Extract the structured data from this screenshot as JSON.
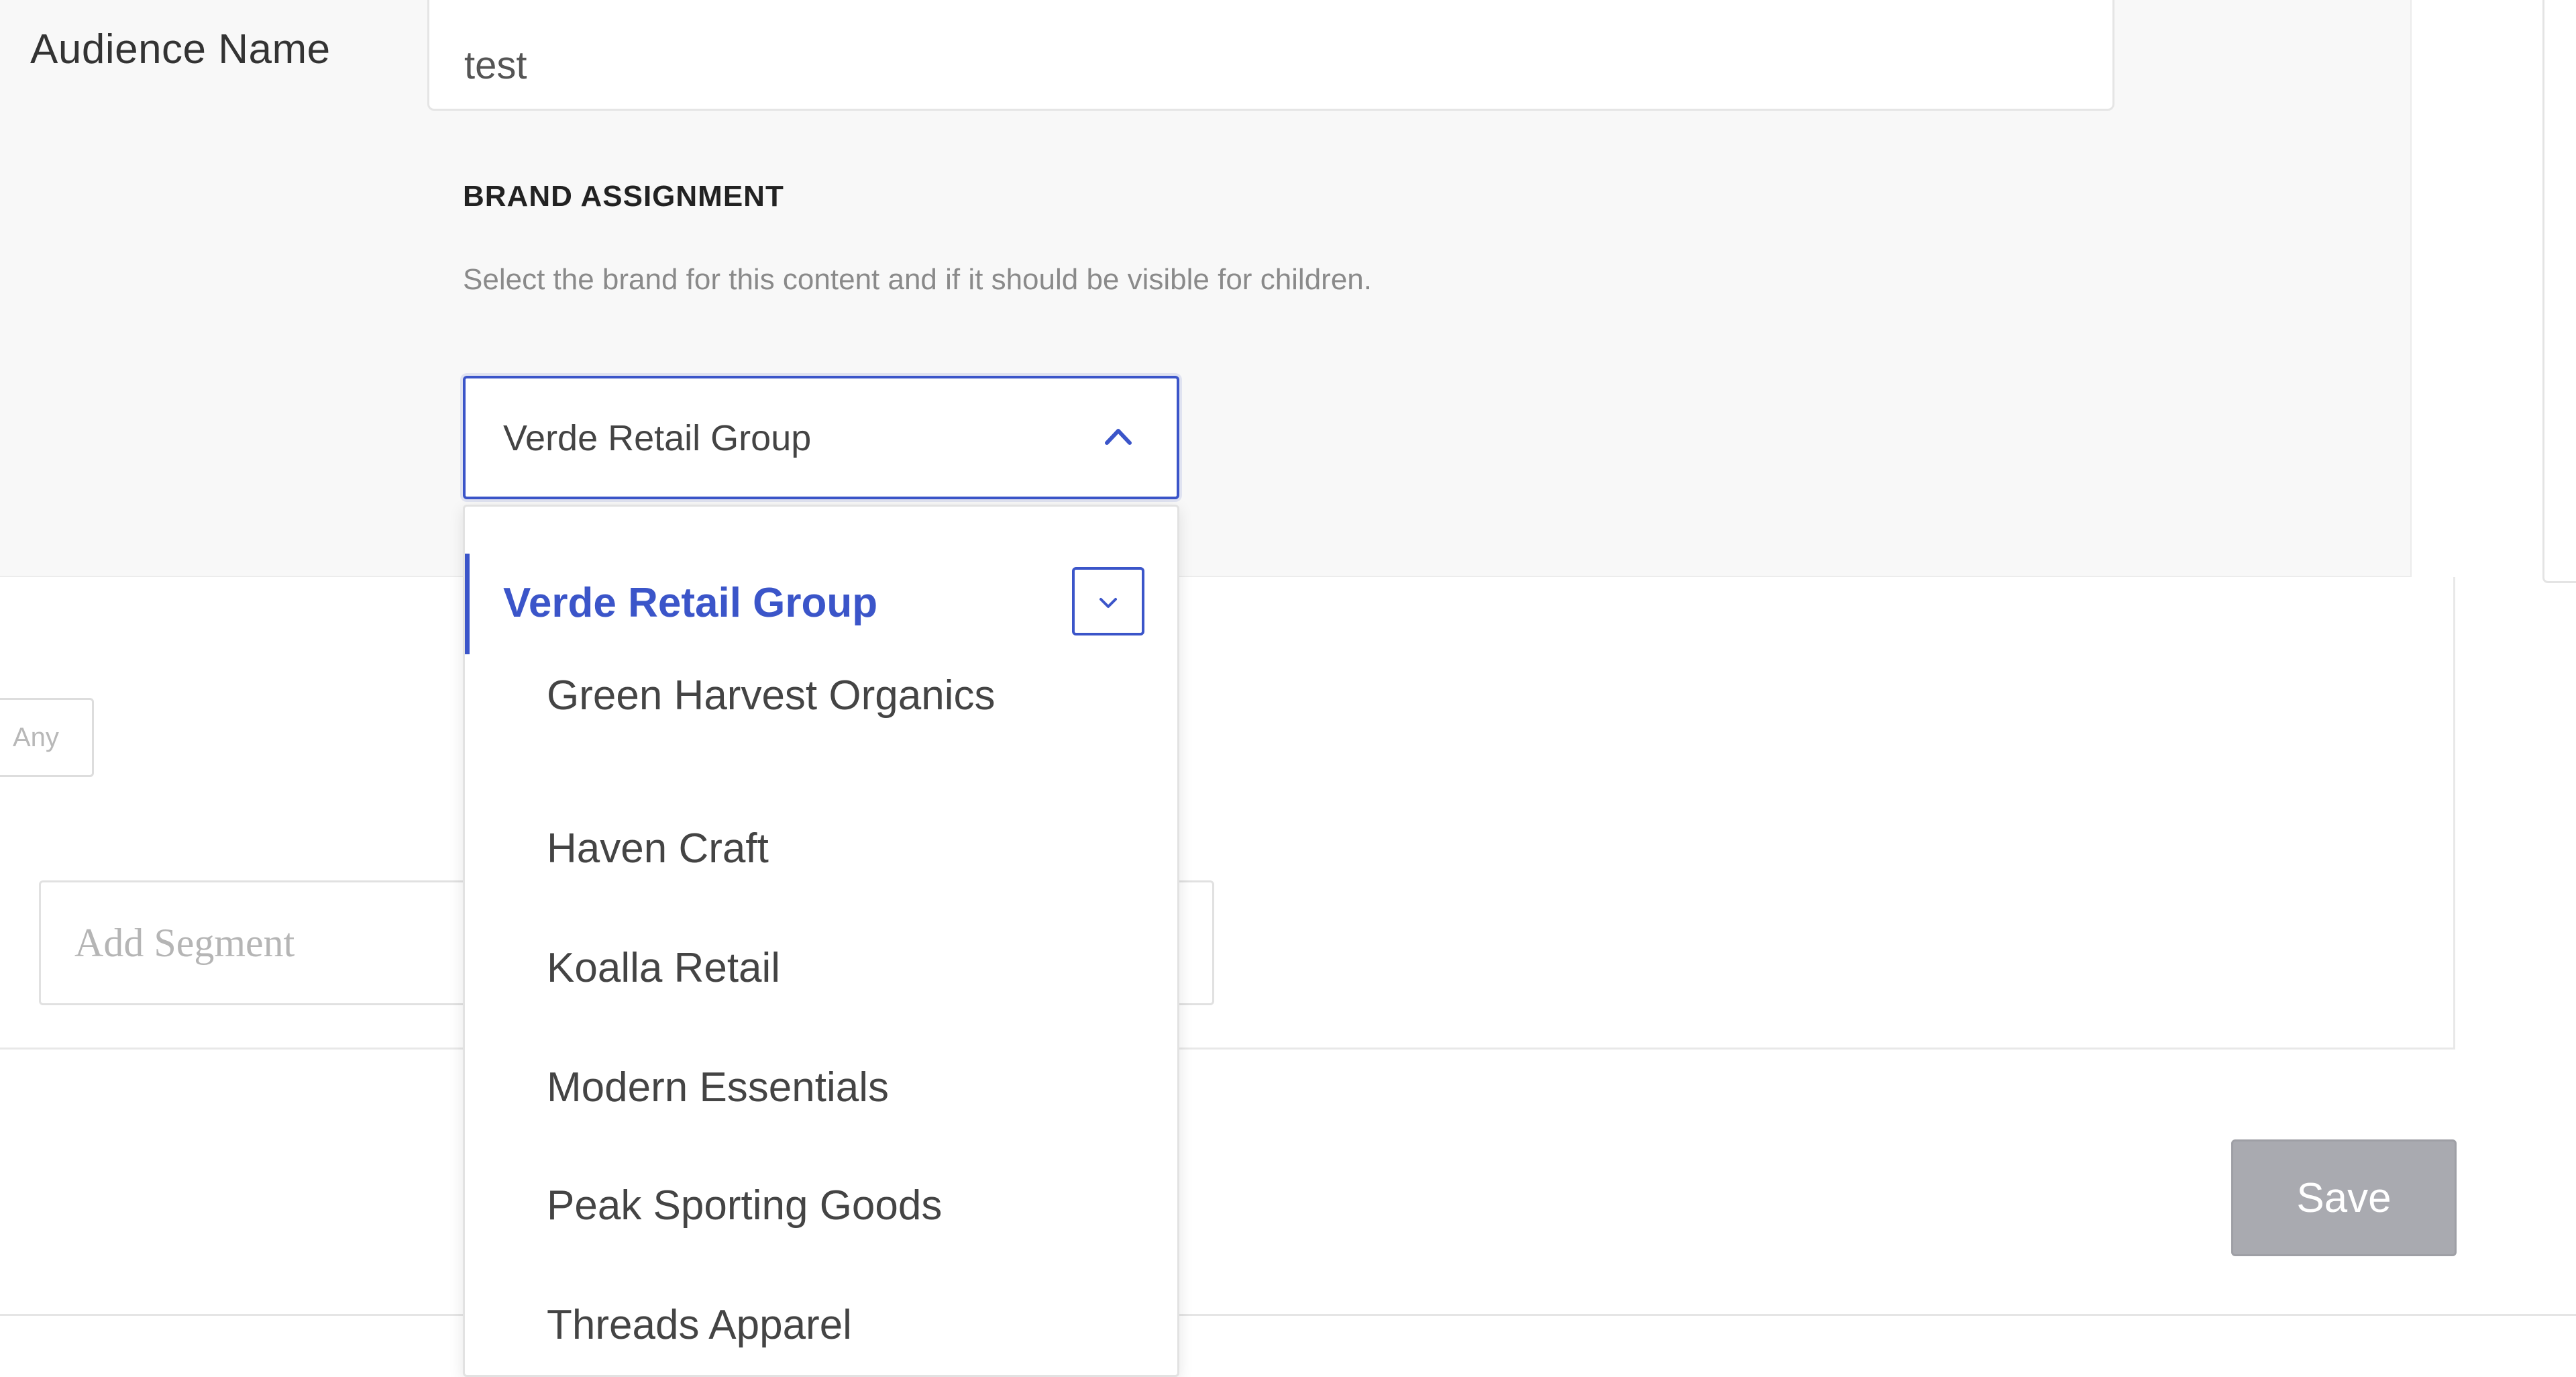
{
  "form": {
    "audience_name_label": "Audience Name",
    "audience_name_value": "test"
  },
  "brand_assignment": {
    "heading": "BRAND ASSIGNMENT",
    "help_text": "Select the brand for this content and if it should be visible for children.",
    "selected_value": "Verde Retail Group"
  },
  "dropdown": {
    "parent_label": "Verde Retail Group",
    "items": [
      {
        "label": "Green Harvest Organics"
      },
      {
        "label": "Haven Craft"
      },
      {
        "label": "Koalla Retail"
      },
      {
        "label": "Modern Essentials"
      },
      {
        "label": "Peak Sporting Goods"
      },
      {
        "label": "Threads Apparel"
      }
    ]
  },
  "segments": {
    "any_chip": "Any",
    "add_segment_placeholder": "Add Segment"
  },
  "actions": {
    "save_label": "Save"
  },
  "colors": {
    "accent": "#3b55c9",
    "save_disabled": "#a9aab0",
    "panel_bg": "#f8f8f8"
  },
  "icons": {
    "select_toggle": "chevron-up-icon",
    "expand_toggle": "chevron-down-icon"
  }
}
